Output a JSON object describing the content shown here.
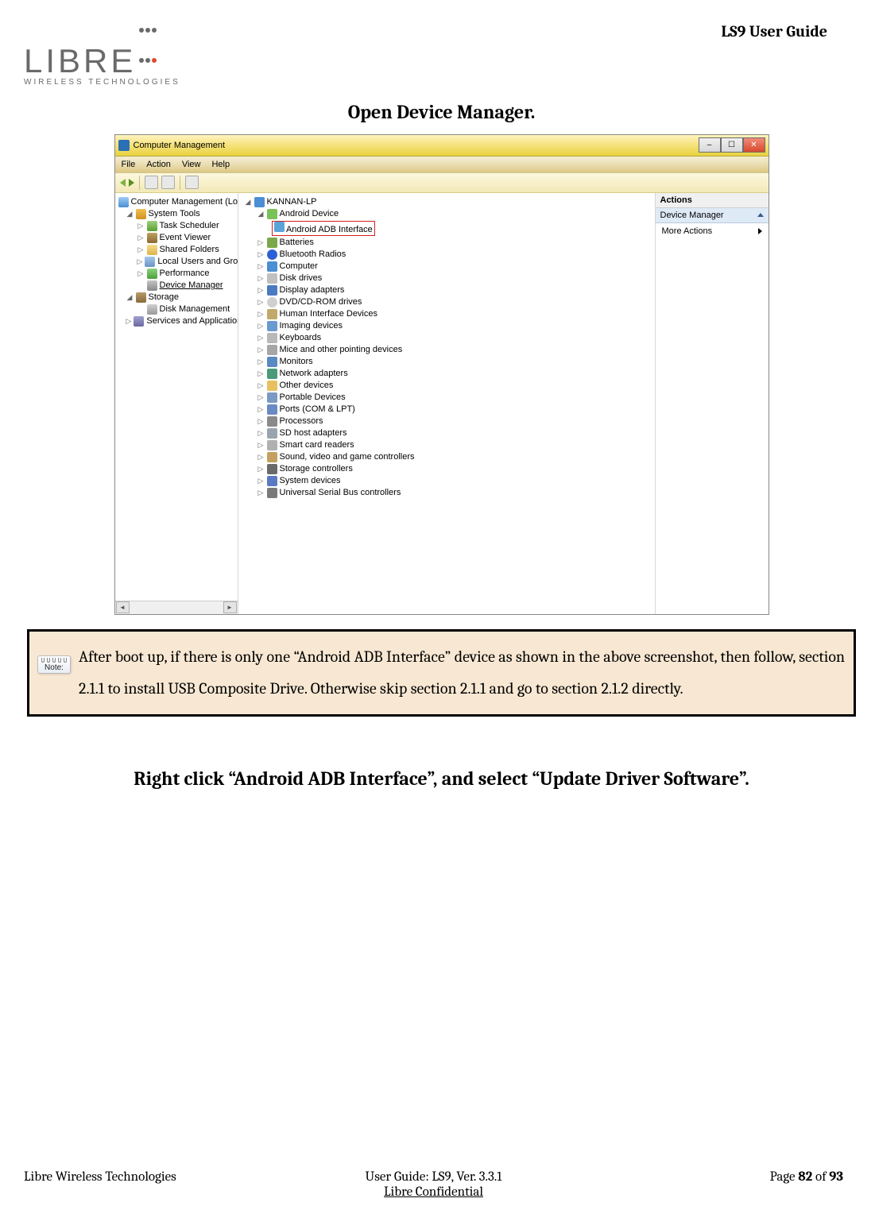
{
  "header": {
    "logo_main": "LIBRE",
    "logo_sub": "WIRELESS TECHNOLOGIES",
    "doc_title": "LS9 User Guide"
  },
  "heading1": "Open Device Manager.",
  "screenshot": {
    "window_title": "Computer Management",
    "menus": [
      "File",
      "Action",
      "View",
      "Help"
    ],
    "left_tree": {
      "root": "Computer Management (Local)",
      "system_tools": {
        "label": "System Tools",
        "children": [
          "Task Scheduler",
          "Event Viewer",
          "Shared Folders",
          "Local Users and Groups",
          "Performance",
          "Device Manager"
        ]
      },
      "storage": {
        "label": "Storage",
        "children": [
          "Disk Management"
        ]
      },
      "services": "Services and Applications"
    },
    "mid_tree": {
      "root": "KANNAN-LP",
      "android_device": {
        "label": "Android Device",
        "child": "Android ADB Interface"
      },
      "categories": [
        "Batteries",
        "Bluetooth Radios",
        "Computer",
        "Disk drives",
        "Display adapters",
        "DVD/CD-ROM drives",
        "Human Interface Devices",
        "Imaging devices",
        "Keyboards",
        "Mice and other pointing devices",
        "Monitors",
        "Network adapters",
        "Other devices",
        "Portable Devices",
        "Ports (COM & LPT)",
        "Processors",
        "SD host adapters",
        "Smart card readers",
        "Sound, video and game controllers",
        "Storage controllers",
        "System devices",
        "Universal Serial Bus controllers"
      ]
    },
    "actions": {
      "header": "Actions",
      "section": "Device Manager",
      "more": "More Actions"
    }
  },
  "note": {
    "icon_label": "Note:",
    "text": "After boot up, if there is only one “Android ADB Interface” device as shown in the above screenshot, then follow, section 2.1.1 to install USB Composite Drive. Otherwise skip section 2.1.1 and go to section 2.1.2 directly."
  },
  "heading2": "Right click “Android ADB Interface”, and select “Update Driver Software”.",
  "footer": {
    "left": "Libre Wireless Technologies",
    "center": "User Guide: LS9, Ver. 3.3.1",
    "right_pre": "Page ",
    "right_page": "82",
    "right_mid": " of ",
    "right_total": "93",
    "confidential": "Libre Confidential"
  }
}
